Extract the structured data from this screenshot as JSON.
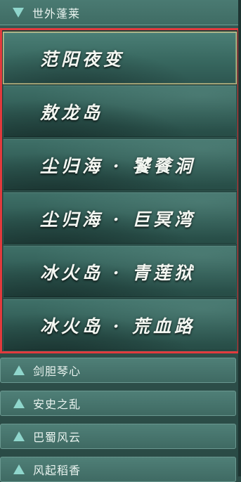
{
  "expanded_category": {
    "label": "世外蓬莱",
    "arrow_icon": "triangle-down-icon"
  },
  "sub_items": [
    {
      "label": "范阳夜变",
      "selected": true
    },
    {
      "label": "敖龙岛",
      "selected": false
    },
    {
      "label": "尘归海 · 饕餮洞",
      "selected": false
    },
    {
      "label": "尘归海 · 巨冥湾",
      "selected": false
    },
    {
      "label": "冰火岛 · 青莲狱",
      "selected": false
    },
    {
      "label": "冰火岛 · 荒血路",
      "selected": false
    }
  ],
  "collapsed_categories": [
    {
      "label": "剑胆琴心",
      "arrow_icon": "triangle-up-icon"
    },
    {
      "label": "安史之乱",
      "arrow_icon": "triangle-up-icon"
    },
    {
      "label": "巴蜀风云",
      "arrow_icon": "triangle-up-icon"
    },
    {
      "label": "风起稻香",
      "arrow_icon": "triangle-up-icon"
    }
  ],
  "colors": {
    "highlight_outline": "#e23a3d",
    "arrow": "#8fd6cc",
    "selected_border": "#d8c98a"
  }
}
